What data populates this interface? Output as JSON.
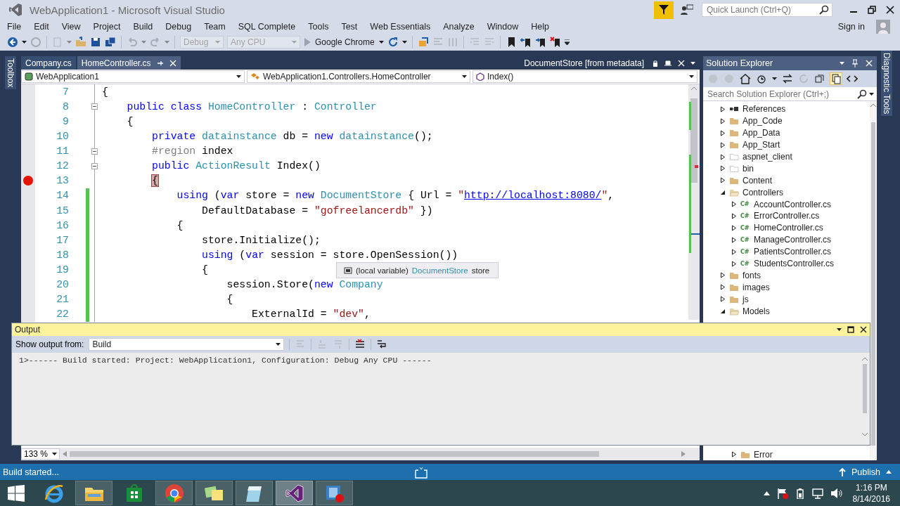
{
  "window": {
    "title": "WebApplication1 - Microsoft Visual Studio"
  },
  "quick_launch": {
    "placeholder": "Quick Launch (Ctrl+Q)"
  },
  "menu": [
    "File",
    "Edit",
    "View",
    "Project",
    "Build",
    "Debug",
    "Team",
    "SQL Complete",
    "Tools",
    "Test",
    "Web Essentials",
    "Analyze",
    "Window",
    "Help"
  ],
  "account": {
    "label": "Sign in"
  },
  "toolbar": [
    {
      "kind": "dropdown",
      "label": "Debug",
      "disabled": true
    },
    {
      "kind": "dropdown",
      "label": "Any CPU",
      "disabled": true
    },
    {
      "kind": "run",
      "label": "Google Chrome",
      "disabled": false
    }
  ],
  "side_tabs": {
    "left": "Toolbox",
    "right": "Diagnostic Tools"
  },
  "editor": {
    "tabs": [
      {
        "label": "Company.cs",
        "selected": false
      },
      {
        "label": "HomeController.cs",
        "selected": true
      }
    ],
    "preview_tab": "DocumentStore [from metadata]",
    "nav": [
      "WebApplication1",
      "WebApplication1.Controllers.HomeController",
      "Index()"
    ],
    "lines": [
      {
        "number": "7",
        "breakpoint": false,
        "changed": false,
        "fold": false,
        "tokens": [
          {
            "kind": "plain",
            "text": "{"
          }
        ]
      },
      {
        "number": "8",
        "breakpoint": false,
        "changed": false,
        "fold": true,
        "tokens": [
          {
            "kind": "keyword",
            "text": "    public class"
          },
          {
            "kind": "type",
            "text": " HomeController"
          },
          {
            "kind": "plain",
            "text": " : "
          },
          {
            "kind": "type",
            "text": "Controller"
          }
        ]
      },
      {
        "number": "9",
        "breakpoint": false,
        "changed": false,
        "fold": false,
        "tokens": [
          {
            "kind": "plain",
            "text": "    {"
          }
        ]
      },
      {
        "number": "10",
        "breakpoint": false,
        "changed": false,
        "fold": false,
        "tokens": [
          {
            "kind": "keyword",
            "text": "        private"
          },
          {
            "kind": "type",
            "text": " datainstance"
          },
          {
            "kind": "plain",
            "text": " db = "
          },
          {
            "kind": "keyword",
            "text": "new"
          },
          {
            "kind": "type",
            "text": " datainstance"
          },
          {
            "kind": "plain",
            "text": "();"
          }
        ]
      },
      {
        "number": "11",
        "breakpoint": false,
        "changed": false,
        "fold": true,
        "tokens": [
          {
            "kind": "directive",
            "text": "        #region"
          },
          {
            "kind": "plain",
            "text": " index"
          }
        ]
      },
      {
        "number": "12",
        "breakpoint": false,
        "changed": false,
        "fold": true,
        "tokens": [
          {
            "kind": "keyword",
            "text": "        public"
          },
          {
            "kind": "type",
            "text": " ActionResult"
          },
          {
            "kind": "plain",
            "text": " Index()"
          }
        ]
      },
      {
        "number": "13",
        "breakpoint": true,
        "changed": false,
        "fold": false,
        "tokens": [
          {
            "kind": "match",
            "text": "        {"
          }
        ]
      },
      {
        "number": "14",
        "breakpoint": false,
        "changed": true,
        "fold": false,
        "tokens": [
          {
            "kind": "keyword",
            "text": "            using"
          },
          {
            "kind": "plain",
            "text": " ("
          },
          {
            "kind": "keyword",
            "text": "var"
          },
          {
            "kind": "plain",
            "text": " store = "
          },
          {
            "kind": "keyword",
            "text": "new"
          },
          {
            "kind": "type",
            "text": " DocumentStore"
          },
          {
            "kind": "plain",
            "text": " { Url = "
          },
          {
            "kind": "string",
            "text": "\""
          },
          {
            "kind": "link",
            "text": "http://localhost:8080/"
          },
          {
            "kind": "string",
            "text": "\""
          },
          {
            "kind": "plain",
            "text": ","
          }
        ]
      },
      {
        "number": "15",
        "breakpoint": false,
        "changed": true,
        "fold": false,
        "tokens": [
          {
            "kind": "plain",
            "text": "                DefaultDatabase = "
          },
          {
            "kind": "string",
            "text": "\"gofreelancerdb\""
          },
          {
            "kind": "plain",
            "text": " })"
          }
        ]
      },
      {
        "number": "16",
        "breakpoint": false,
        "changed": true,
        "fold": false,
        "tokens": [
          {
            "kind": "plain",
            "text": "            {"
          }
        ]
      },
      {
        "number": "17",
        "breakpoint": false,
        "changed": true,
        "fold": false,
        "tokens": [
          {
            "kind": "plain",
            "text": "                store.Initialize();"
          }
        ]
      },
      {
        "number": "18",
        "breakpoint": false,
        "changed": true,
        "fold": false,
        "tokens": [
          {
            "kind": "keyword",
            "text": "                using"
          },
          {
            "kind": "plain",
            "text": " ("
          },
          {
            "kind": "keyword",
            "text": "var"
          },
          {
            "kind": "plain",
            "text": " session = store.OpenSession())"
          }
        ]
      },
      {
        "number": "19",
        "breakpoint": false,
        "changed": true,
        "fold": false,
        "tokens": [
          {
            "kind": "plain",
            "text": "                {"
          }
        ]
      },
      {
        "number": "20",
        "breakpoint": false,
        "changed": true,
        "fold": false,
        "tokens": [
          {
            "kind": "plain",
            "text": "                    session.Store("
          },
          {
            "kind": "keyword",
            "text": "new"
          },
          {
            "kind": "type",
            "text": " Company"
          }
        ]
      },
      {
        "number": "21",
        "breakpoint": false,
        "changed": true,
        "fold": false,
        "tokens": [
          {
            "kind": "plain",
            "text": "                    {"
          }
        ]
      },
      {
        "number": "22",
        "breakpoint": false,
        "changed": true,
        "fold": false,
        "tokens": [
          {
            "kind": "plain",
            "text": "                        ExternalId = "
          },
          {
            "kind": "string",
            "text": "\"dev\""
          },
          {
            "kind": "plain",
            "text": ","
          }
        ]
      }
    ],
    "tooltip": {
      "label": "(local variable)",
      "type": "DocumentStore",
      "name": "store"
    },
    "zoom": "133 %"
  },
  "solution_explorer": {
    "title": "Solution Explorer",
    "search": {
      "placeholder": "Search Solution Explorer (Ctrl+;)"
    },
    "items": [
      {
        "label": "References",
        "kind": "references",
        "expanded": false
      },
      {
        "label": "App_Code",
        "kind": "folder",
        "expanded": false
      },
      {
        "label": "App_Data",
        "kind": "folder",
        "expanded": false
      },
      {
        "label": "App_Start",
        "kind": "folder",
        "expanded": false
      },
      {
        "label": "aspnet_client",
        "kind": "excluded",
        "expanded": false
      },
      {
        "label": "bin",
        "kind": "excluded",
        "expanded": false
      },
      {
        "label": "Content",
        "kind": "folder",
        "expanded": false
      },
      {
        "label": "Controllers",
        "kind": "folder",
        "expanded": true,
        "children": [
          {
            "label": "AccountController.cs",
            "kind": "csharp",
            "icon_text": "C#",
            "expanded": false
          },
          {
            "label": "ErrorController.cs",
            "kind": "csharp",
            "icon_text": "C#",
            "expanded": false
          },
          {
            "label": "HomeController.cs",
            "kind": "csharp",
            "icon_text": "C#",
            "expanded": false
          },
          {
            "label": "ManageController.cs",
            "kind": "csharp",
            "icon_text": "C#",
            "expanded": false
          },
          {
            "label": "PatientsController.cs",
            "kind": "csharp",
            "icon_text": "C#",
            "expanded": false
          },
          {
            "label": "StudentsController.cs",
            "kind": "csharp",
            "icon_text": "C#",
            "expanded": false
          }
        ]
      },
      {
        "label": "fonts",
        "kind": "folder",
        "expanded": false
      },
      {
        "label": "images",
        "kind": "folder",
        "expanded": false
      },
      {
        "label": "js",
        "kind": "folder",
        "expanded": false
      },
      {
        "label": "Models",
        "kind": "folder",
        "expanded": true,
        "children": [
          {
            "label": "Error",
            "kind": "folder",
            "expanded": false
          }
        ]
      }
    ]
  },
  "output": {
    "title": "Output",
    "source_label": "Show output from:",
    "source": "Build",
    "lines": [
      "1>------ Build started: Project: WebApplication1, Configuration: Debug Any CPU ------"
    ]
  },
  "status_bar": {
    "message": "Build started...",
    "publish": "Publish"
  },
  "taskbar": {
    "apps": [
      {
        "kind": "ie",
        "selected": false,
        "running": false
      },
      {
        "kind": "explorer",
        "selected": false,
        "running": true
      },
      {
        "kind": "store",
        "selected": false,
        "running": false
      },
      {
        "kind": "chrome",
        "selected": false,
        "running": true
      },
      {
        "kind": "sticky",
        "selected": false,
        "running": true
      },
      {
        "kind": "notepad",
        "selected": false,
        "running": true
      },
      {
        "kind": "vs",
        "selected": true,
        "running": true
      },
      {
        "kind": "recorder",
        "selected": false,
        "running": true
      }
    ],
    "time": "1:16 PM",
    "date": "8/14/2016"
  }
}
